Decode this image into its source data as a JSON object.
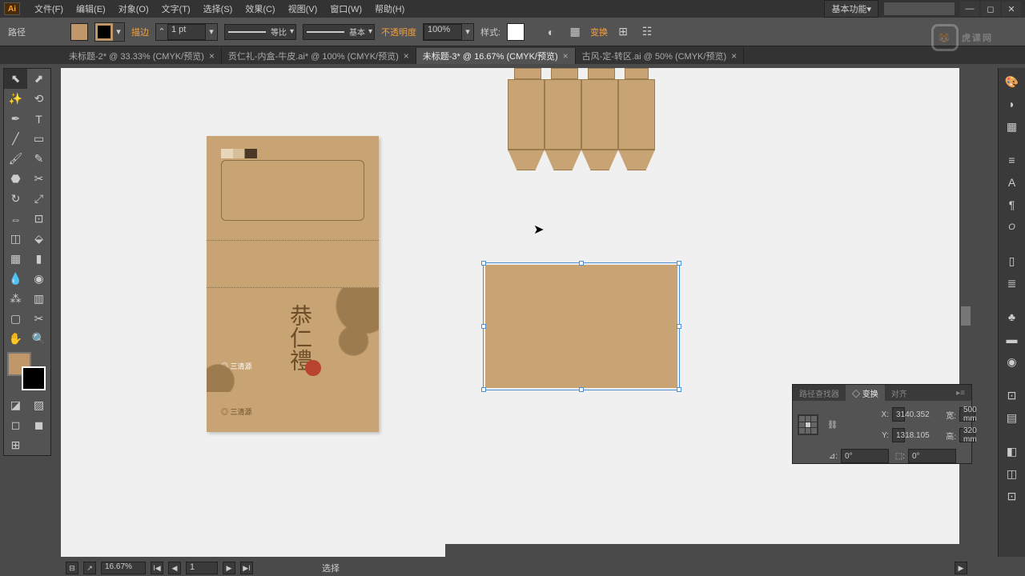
{
  "menu": {
    "items": [
      "文件(F)",
      "编辑(E)",
      "对象(O)",
      "文字(T)",
      "选择(S)",
      "效果(C)",
      "视图(V)",
      "窗口(W)",
      "帮助(H)"
    ],
    "workspace": "基本功能"
  },
  "options": {
    "selection_label": "路径",
    "stroke_label": "描边",
    "stroke_weight": "1 pt",
    "stroke_profile_label": "等比",
    "brush_label": "基本",
    "opacity_label": "不透明度",
    "opacity_value": "100%",
    "style_label": "样式:",
    "transform_label": "变换"
  },
  "tabs": [
    {
      "label": "未标题-2* @ 33.33% (CMYK/预览)",
      "active": false
    },
    {
      "label": "贡仁礼-内盒-牛皮.ai* @ 100% (CMYK/预览)",
      "active": false
    },
    {
      "label": "未标题-3* @ 16.67% (CMYK/预览)",
      "active": true
    },
    {
      "label": "古风-定-转区.ai @ 50% (CMYK/预览)",
      "active": false
    }
  ],
  "artboard1": {
    "vertical_text": "恭仁禮",
    "logo_text": "◎ 三清源",
    "sublogo_text": "◎ 三清源"
  },
  "transform": {
    "tab1": "路径查找器",
    "tab2": "◇ 变换",
    "tab3": "对齐",
    "x_label": "X:",
    "x_value": "3140.352",
    "y_label": "Y:",
    "y_value": "1318.105",
    "w_label": "宽:",
    "w_value": "500 mm",
    "h_label": "高:",
    "h_value": "320 mm",
    "rot_label": "⊿:",
    "rot_value": "0°",
    "shear_label": "⬚:",
    "shear_value": "0°"
  },
  "status": {
    "zoom": "16.67%",
    "page": "1",
    "tool": "选择"
  },
  "watermark": {
    "text": "虎课网"
  },
  "colors": {
    "kraft": "#c8a373",
    "accent": "#f8a03a"
  }
}
